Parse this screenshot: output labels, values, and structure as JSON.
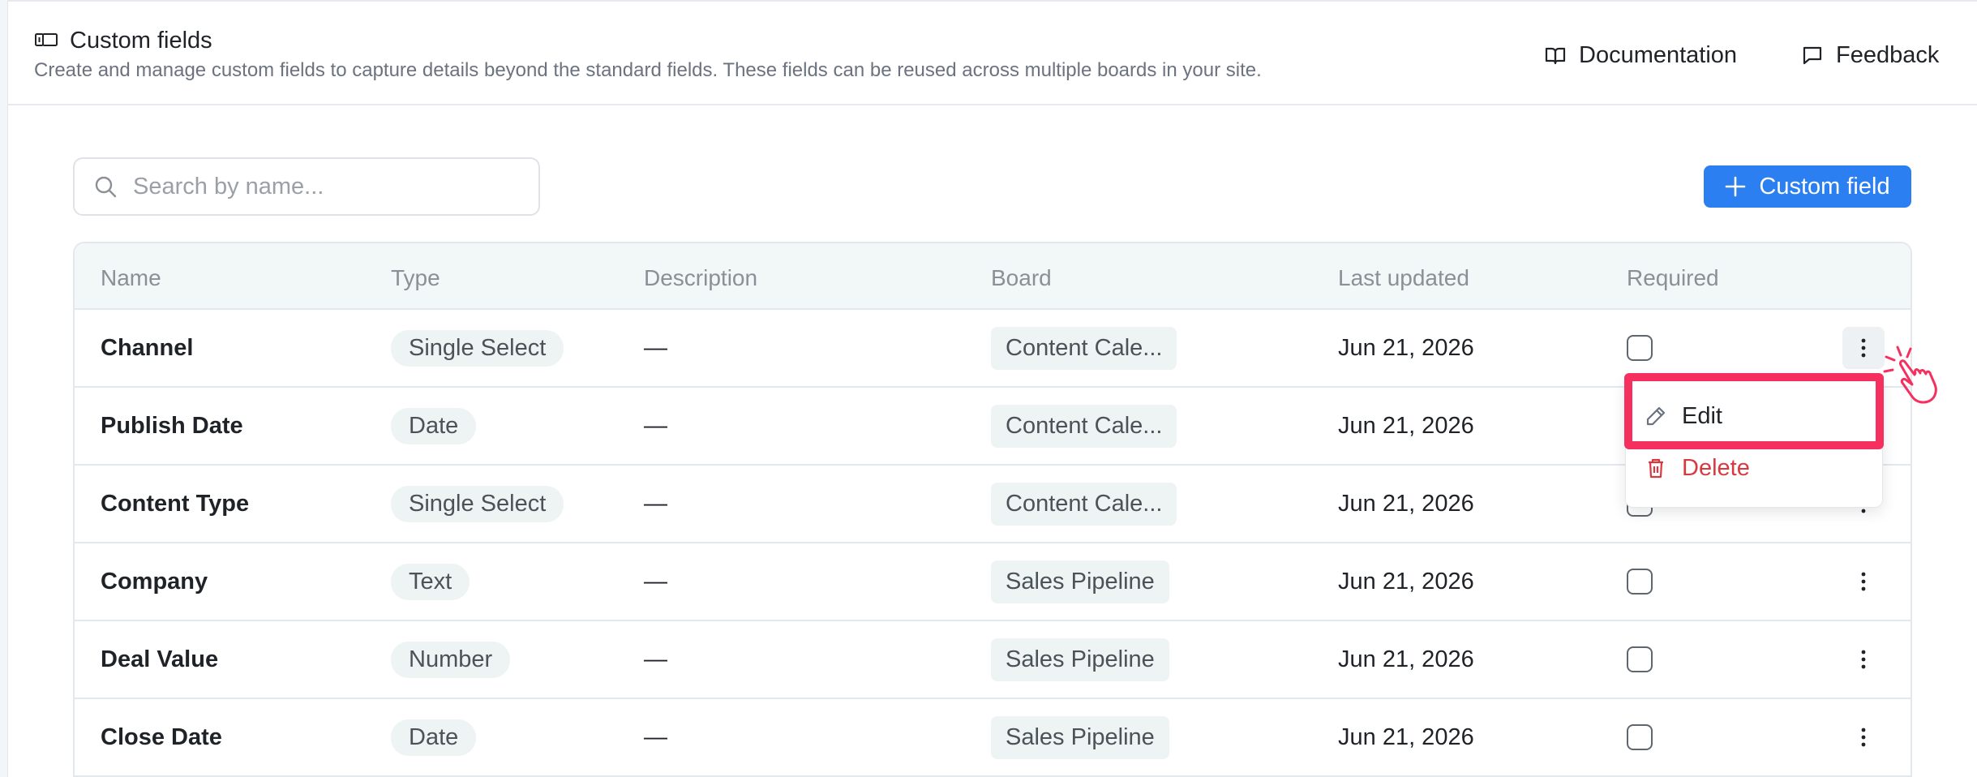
{
  "header": {
    "title": "Custom fields",
    "subtitle": "Create and manage custom fields to capture details beyond the standard fields. These fields can be reused across multiple boards in your site.",
    "documentation_label": "Documentation",
    "feedback_label": "Feedback"
  },
  "search": {
    "placeholder": "Search by name..."
  },
  "add_button_label": "Custom field",
  "columns": [
    "Name",
    "Type",
    "Description",
    "Board",
    "Last updated",
    "Required"
  ],
  "rows": [
    {
      "name": "Channel",
      "type": "Single Select",
      "description": "—",
      "board": "Content Cale...",
      "updated": "Jun 21, 2026",
      "required": false
    },
    {
      "name": "Publish Date",
      "type": "Date",
      "description": "—",
      "board": "Content Cale...",
      "updated": "Jun 21, 2026",
      "required": false
    },
    {
      "name": "Content Type",
      "type": "Single Select",
      "description": "—",
      "board": "Content Cale...",
      "updated": "Jun 21, 2026",
      "required": false
    },
    {
      "name": "Company",
      "type": "Text",
      "description": "—",
      "board": "Sales Pipeline",
      "updated": "Jun 21, 2026",
      "required": false
    },
    {
      "name": "Deal Value",
      "type": "Number",
      "description": "—",
      "board": "Sales Pipeline",
      "updated": "Jun 21, 2026",
      "required": false
    },
    {
      "name": "Close Date",
      "type": "Date",
      "description": "—",
      "board": "Sales Pipeline",
      "updated": "Jun 21, 2026",
      "required": false
    }
  ],
  "row_menu": {
    "edit_label": "Edit",
    "delete_label": "Delete"
  },
  "colors": {
    "accent": "#2b7ff0",
    "danger": "#d9393e",
    "highlight": "#f5305e"
  },
  "icons": {
    "title": "custom-fields-icon",
    "documentation": "book-icon",
    "feedback": "chat-icon",
    "search": "search-icon",
    "add": "plus-icon",
    "row_menu": "more-vertical-icon",
    "edit": "pencil-icon",
    "delete": "trash-icon",
    "pointer": "hand-pointer-icon"
  }
}
